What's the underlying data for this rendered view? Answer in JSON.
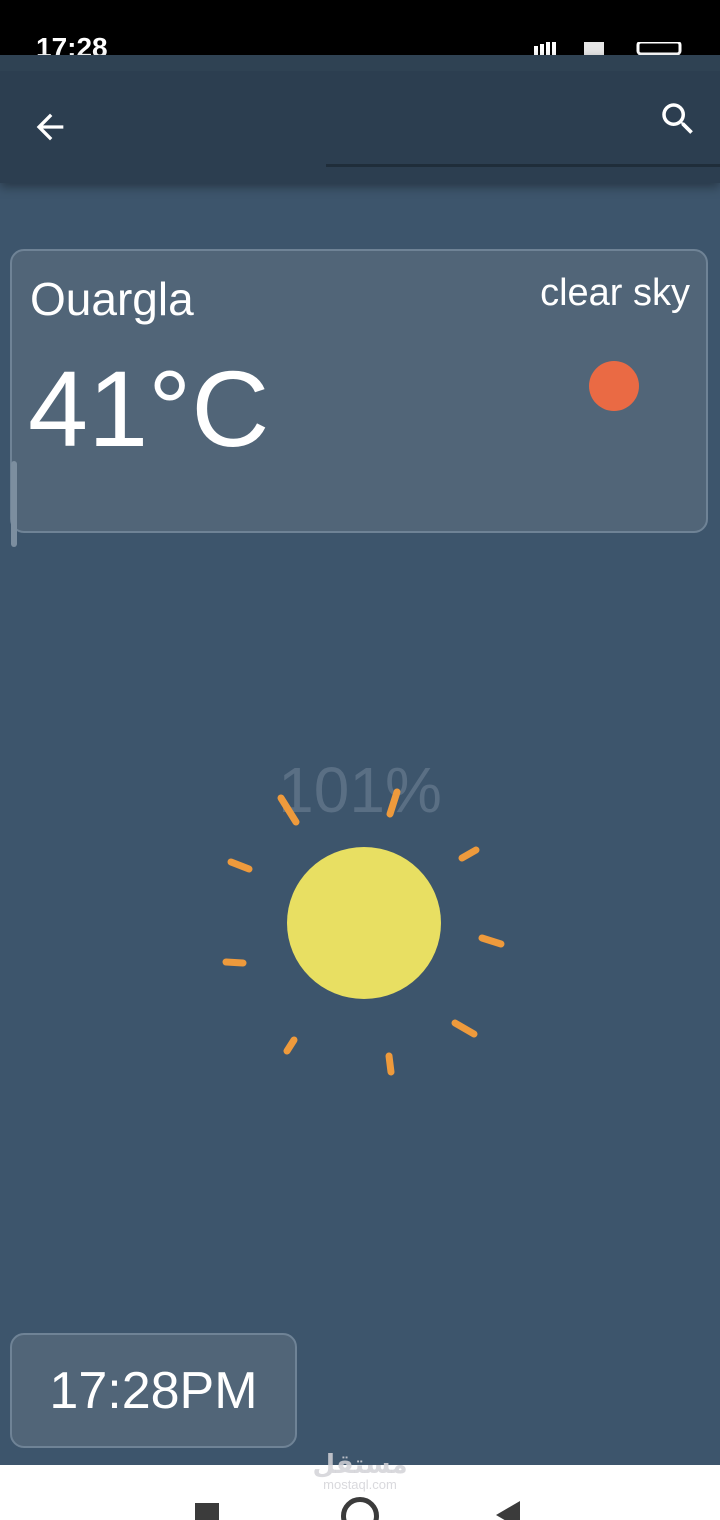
{
  "status_bar": {
    "time": "17:28"
  },
  "app_bar": {
    "back_icon": "arrow-left-icon",
    "search_icon": "search-icon"
  },
  "weather": {
    "city": "Ouargla",
    "condition": "clear sky",
    "temperature": "41°C",
    "condition_icon": "sun-dot-icon",
    "condition_color": "#ea6a44"
  },
  "illustration": {
    "percent": "101%",
    "sun_color": "#e8df62",
    "ray_color": "#ee9a3c"
  },
  "clock": {
    "time": "17:28PM"
  },
  "watermark": {
    "text": "mostaql.com"
  },
  "nav_bar": {
    "icons": [
      "recent-apps-icon",
      "home-icon",
      "back-nav-icon"
    ]
  },
  "colors": {
    "background": "#3d556c",
    "app_bar": "#2c3e50",
    "card": "#516578"
  }
}
